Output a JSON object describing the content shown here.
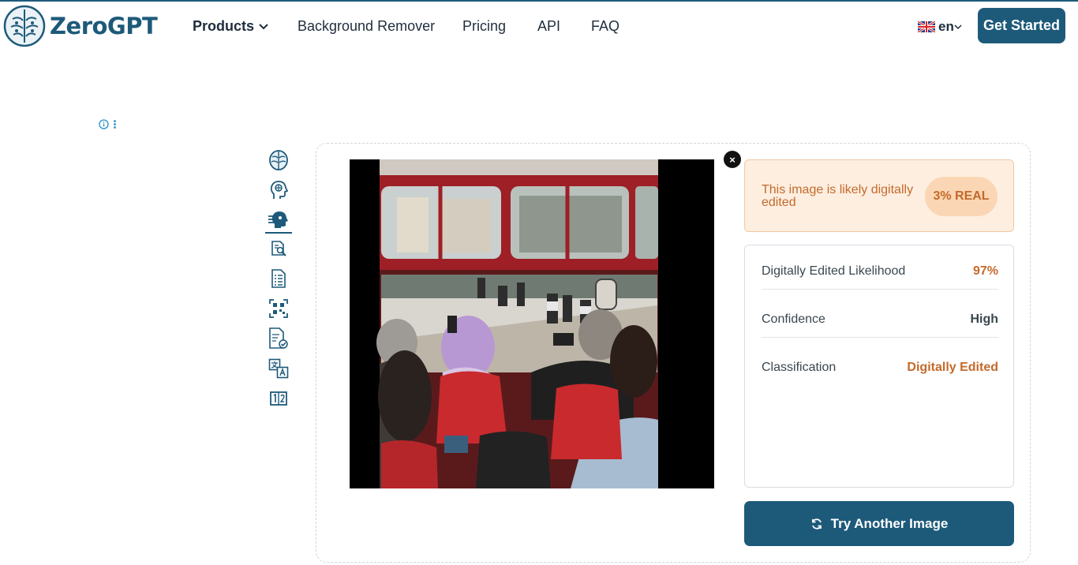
{
  "header": {
    "logo_text": "ZeroGPT",
    "nav": {
      "products": "Products",
      "background_remover": "Background Remover",
      "pricing": "Pricing",
      "api": "API",
      "faq": "FAQ"
    },
    "language": "en",
    "get_started": "Get Started"
  },
  "sidebar_tools": [
    "brain-icon",
    "head-profile-icon",
    "face-scan-icon",
    "document-search-icon",
    "document-list-icon",
    "qr-scan-icon",
    "document-check-icon",
    "translate-icon",
    "counter-icon"
  ],
  "result": {
    "verdict_text": "This image is likely digitally edited",
    "verdict_badge": "3% REAL",
    "rows": [
      {
        "label": "Digitally Edited Likelihood",
        "value": "97%"
      },
      {
        "label": "Confidence",
        "value": "High"
      },
      {
        "label": "Classification",
        "value": "Digitally Edited"
      }
    ],
    "try_another": "Try Another Image"
  },
  "colors": {
    "brand": "#1d5a7a",
    "warning": "#c46a2b",
    "warning_bg": "#fdeee0"
  }
}
